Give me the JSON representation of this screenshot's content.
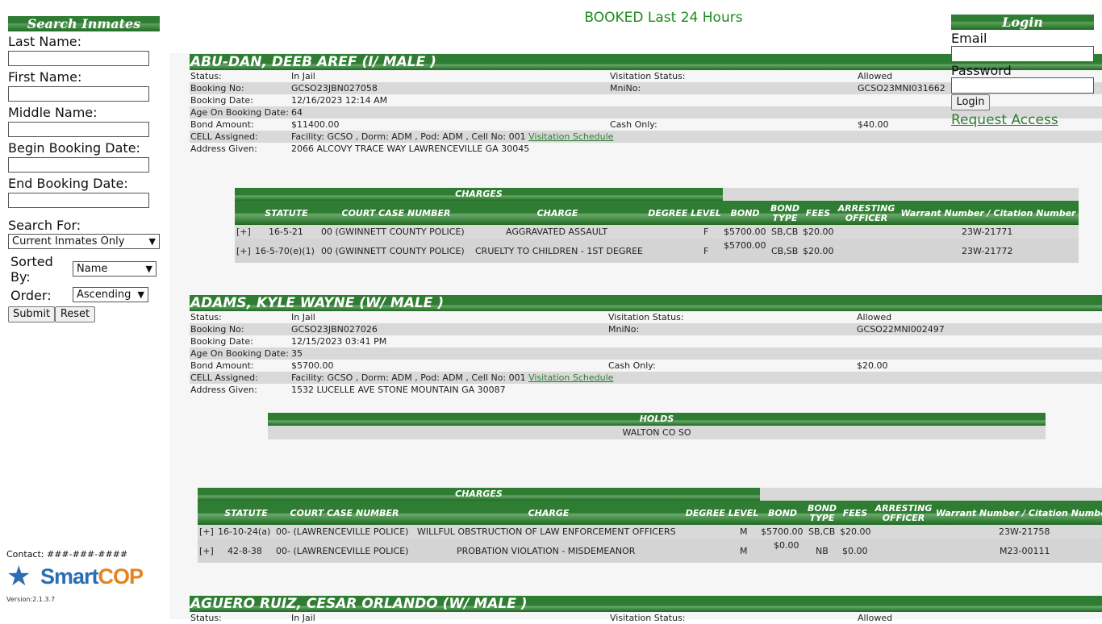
{
  "search": {
    "header": "Search Inmates",
    "last_name_label": "Last Name:",
    "first_name_label": "First Name:",
    "middle_name_label": "Middle Name:",
    "begin_date_label": "Begin Booking Date:",
    "end_date_label": "End Booking Date:",
    "search_for_label": "Search For:",
    "search_for_value": "Current Inmates Only",
    "sorted_by_label": "Sorted By:",
    "sorted_by_value": "Name",
    "order_label": "Order:",
    "order_value": "Ascending",
    "submit_label": "Submit",
    "reset_label": "Reset"
  },
  "footer": {
    "contact": "Contact: ###-###-####",
    "logo_text_a": "Smart",
    "logo_text_b": "COP",
    "version": "Version:2.1.3.7"
  },
  "page_title": "BOOKED Last 24 Hours",
  "login": {
    "header": "Login",
    "email_label": "Email",
    "password_label": "Password",
    "login_button": "Login",
    "request_access": "Request Access"
  },
  "labels": {
    "status": "Status:",
    "visitation_status": "Visitation Status:",
    "booking_no": "Booking No:",
    "mnino": "MniNo:",
    "booking_date": "Booking Date:",
    "age": "Age On Booking Date:",
    "bond_amount": "Bond Amount:",
    "cash_only": "Cash Only:",
    "cell": "CELL Assigned:",
    "address": "Address Given:",
    "visitation_schedule": "Visitation Schedule",
    "charges": "CHARGES",
    "holds": "HOLDS"
  },
  "charge_headers": {
    "statute": "STATUTE",
    "court_case": "COURT CASE NUMBER",
    "charge": "CHARGE",
    "degree": "DEGREE LEVEL",
    "bond": "BOND",
    "bond_type_a": "BOND",
    "bond_type_b": "TYPE",
    "fees": "FEES",
    "officer_a": "ARRESTING",
    "officer_b": "OFFICER",
    "warrant": "Warrant Number / Citation Number"
  },
  "inmates": [
    {
      "name": "ABU-DAN, DEEB AREF   (I/ MALE )",
      "status": "In Jail",
      "visitation": "Allowed",
      "booking_no": "GCSO23JBN027058",
      "mnino": "GCSO23MNI031662",
      "booking_date": "12/16/2023 12:14 AM",
      "age": "64",
      "bond_amount": "$11400.00",
      "cash_only": "$40.00",
      "cell": "Facility: GCSO , Dorm: ADM , Pod: ADM , Cell No: 001",
      "address": "2066 ALCOVY TRACE WAY LAWRENCEVILLE GA 30045",
      "charges": [
        {
          "expand": "[+]",
          "statute": "16-5-21",
          "court_case": "00 (GWINNETT COUNTY POLICE)",
          "charge": "AGGRAVATED ASSAULT",
          "degree": "F",
          "bond": "$5700.00",
          "bond_type": "SB,CB",
          "fees": "$20.00",
          "warrant": "23W-21771"
        },
        {
          "expand": "[+]",
          "statute": "16-5-70(e)(1)",
          "court_case": "00 (GWINNETT COUNTY POLICE)",
          "charge": "CRUELTY TO CHILDREN - 1ST DEGREE",
          "degree": "F",
          "bond": "$5700.00",
          "bond_type": "CB,SB",
          "fees": "$20.00",
          "warrant": "23W-21772"
        }
      ]
    },
    {
      "name": "ADAMS, KYLE WAYNE   (W/ MALE )",
      "status": "In Jail",
      "visitation": "Allowed",
      "booking_no": "GCSO23JBN027026",
      "mnino": "GCSO22MNI002497",
      "booking_date": "12/15/2023 03:41 PM",
      "age": "35",
      "bond_amount": "$5700.00",
      "cash_only": "$20.00",
      "cell": "Facility: GCSO , Dorm: ADM , Pod: ADM , Cell No: 001",
      "address": "1532 LUCELLE AVE STONE MOUNTAIN GA 30087",
      "holds": [
        "WALTON CO SO"
      ],
      "charges": [
        {
          "expand": "[+]",
          "statute": "16-10-24(a)",
          "court_case": "00- (LAWRENCEVILLE POLICE)",
          "charge": "WILLFUL OBSTRUCTION OF LAW ENFORCEMENT OFFICERS",
          "degree": "M",
          "bond": "$5700.00",
          "bond_type": "SB,CB",
          "fees": "$20.00",
          "warrant": "23W-21758"
        },
        {
          "expand": "[+]",
          "statute": "42-8-38",
          "court_case": "00- (LAWRENCEVILLE POLICE)",
          "charge": "PROBATION VIOLATION - MISDEMEANOR",
          "degree": "M",
          "bond": "$0.00",
          "bond_type": "NB",
          "fees": "$0.00",
          "warrant": "M23-00111"
        }
      ]
    },
    {
      "name": "AGUERO RUIZ, CESAR ORLANDO   (W/ MALE )",
      "status": "In Jail",
      "visitation": "Allowed"
    }
  ]
}
